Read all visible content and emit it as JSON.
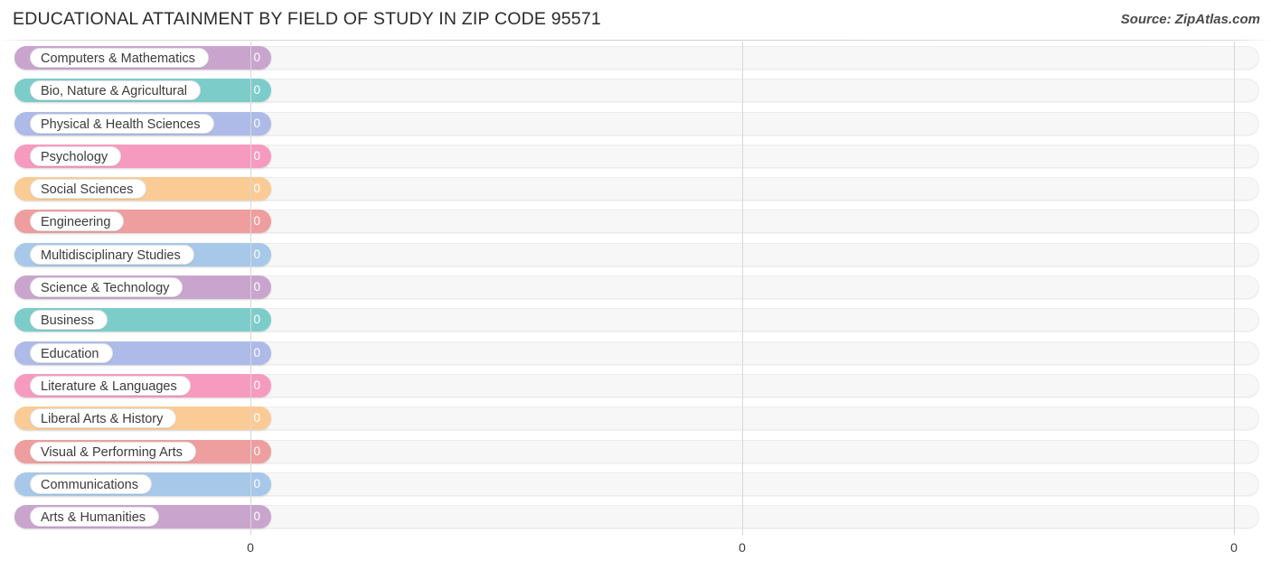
{
  "header": {
    "title": "EDUCATIONAL ATTAINMENT BY FIELD OF STUDY IN ZIP CODE 95571",
    "source": "Source: ZipAtlas.com"
  },
  "chart_data": {
    "type": "bar",
    "orientation": "horizontal",
    "title": "EDUCATIONAL ATTAINMENT BY FIELD OF STUDY IN ZIP CODE 95571",
    "xlabel": "",
    "ylabel": "",
    "xlim": [
      0,
      0
    ],
    "grid": true,
    "legend": "none",
    "axis_ticks": [
      "0",
      "0",
      "0"
    ],
    "categories": [
      "Computers & Mathematics",
      "Bio, Nature & Agricultural",
      "Physical & Health Sciences",
      "Psychology",
      "Social Sciences",
      "Engineering",
      "Multidisciplinary Studies",
      "Science & Technology",
      "Business",
      "Education",
      "Literature & Languages",
      "Liberal Arts & History",
      "Visual & Performing Arts",
      "Communications",
      "Arts & Humanities"
    ],
    "values": [
      0,
      0,
      0,
      0,
      0,
      0,
      0,
      0,
      0,
      0,
      0,
      0,
      0,
      0,
      0
    ],
    "value_labels": [
      "0",
      "0",
      "0",
      "0",
      "0",
      "0",
      "0",
      "0",
      "0",
      "0",
      "0",
      "0",
      "0",
      "0",
      "0"
    ],
    "colors": [
      "#c9a5ce",
      "#7ccdca",
      "#aebbe8",
      "#f79ac0",
      "#fbcb96",
      "#ee9e9e",
      "#a7c8e8",
      "#c9a5ce",
      "#7ccdca",
      "#aebbe8",
      "#f79ac0",
      "#fbcb96",
      "#ee9e9e",
      "#a7c8e8",
      "#c9a5ce"
    ]
  }
}
